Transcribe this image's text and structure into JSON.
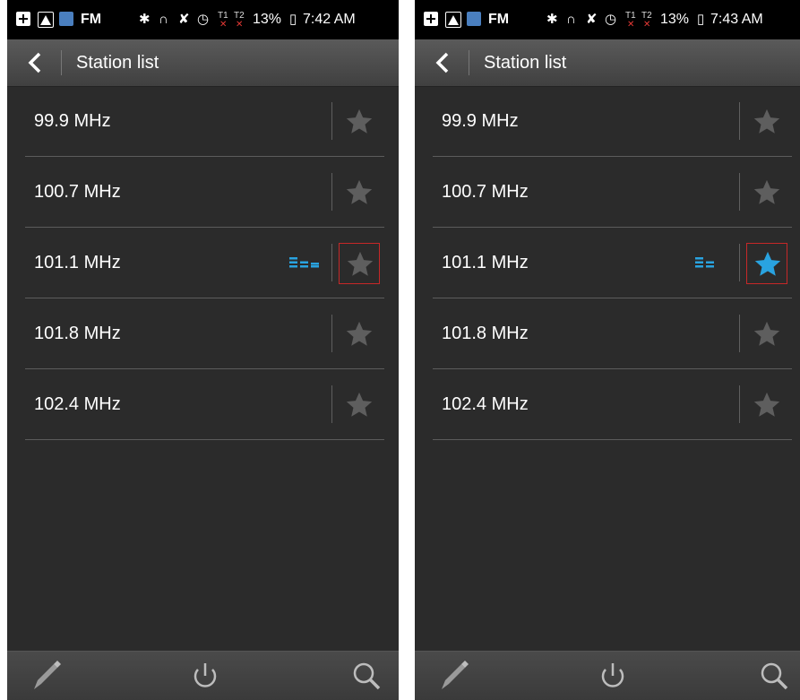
{
  "screens": [
    {
      "status": {
        "fm": "FM",
        "t1": "T1",
        "t2": "T2",
        "battery": "13%",
        "time": "7:42 AM"
      },
      "title": "Station list",
      "stations": [
        {
          "freq": "99.9 MHz",
          "favorite": false,
          "playing": false
        },
        {
          "freq": "100.7 MHz",
          "favorite": false,
          "playing": false
        },
        {
          "freq": "101.1 MHz",
          "favorite": false,
          "playing": true
        },
        {
          "freq": "101.8 MHz",
          "favorite": false,
          "playing": false
        },
        {
          "freq": "102.4 MHz",
          "favorite": false,
          "playing": false
        }
      ]
    },
    {
      "status": {
        "fm": "FM",
        "t1": "T1",
        "t2": "T2",
        "battery": "13%",
        "time": "7:43 AM"
      },
      "title": "Station list",
      "stations": [
        {
          "freq": "99.9 MHz",
          "favorite": false,
          "playing": false
        },
        {
          "freq": "100.7 MHz",
          "favorite": false,
          "playing": false
        },
        {
          "freq": "101.1 MHz",
          "favorite": true,
          "playing": true
        },
        {
          "freq": "101.8 MHz",
          "favorite": false,
          "playing": false
        },
        {
          "freq": "102.4 MHz",
          "favorite": false,
          "playing": false
        }
      ]
    }
  ],
  "icons": {
    "back": "chevron-left-icon",
    "favorite": "star-icon",
    "playing": "equalizer-icon",
    "edit": "pencil-icon",
    "power": "power-icon",
    "search": "search-icon"
  },
  "colors": {
    "accent": "#29a3e0",
    "star_inactive": "#5e5e5e",
    "highlight_outline": "#c62828"
  }
}
